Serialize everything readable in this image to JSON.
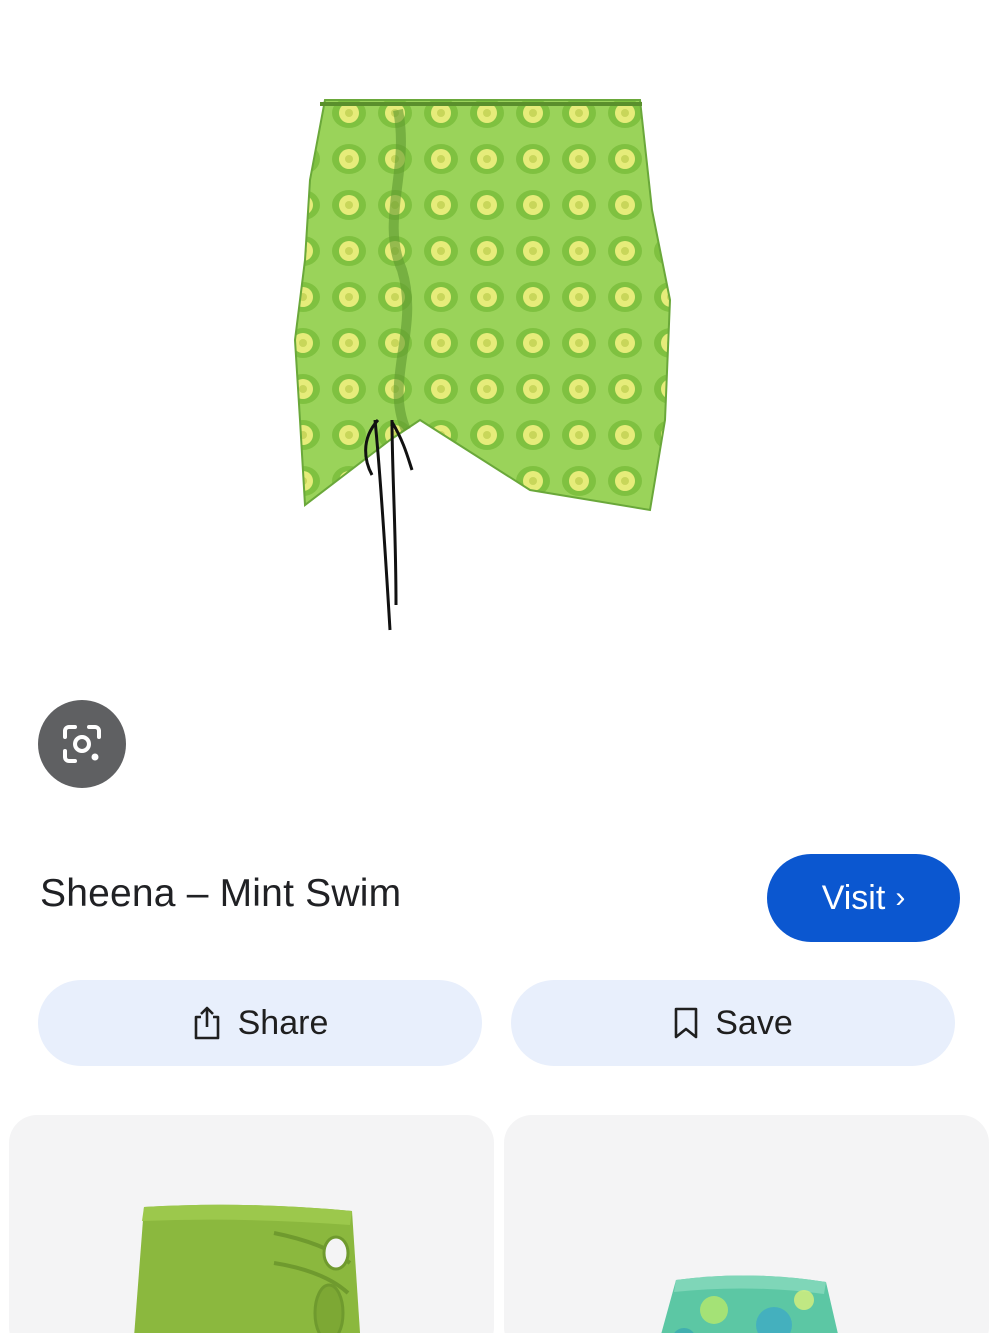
{
  "product": {
    "title": "Sheena – Mint Swim",
    "image_icon": "green-ruched-mini-skirt"
  },
  "lens_button": {
    "icon": "camera-lens-icon"
  },
  "visit_button": {
    "label": "Visit",
    "icon": "chevron-right-icon"
  },
  "actions": {
    "share": {
      "label": "Share",
      "icon": "share-icon"
    },
    "save": {
      "label": "Save",
      "icon": "bookmark-icon"
    }
  },
  "related": [
    {
      "image_icon": "green-cutout-skirt"
    },
    {
      "image_icon": "teal-print-skirt"
    }
  ],
  "colors": {
    "accent": "#0b57d0",
    "action_bg": "#e8effc",
    "lens_bg": "#5f6062"
  }
}
